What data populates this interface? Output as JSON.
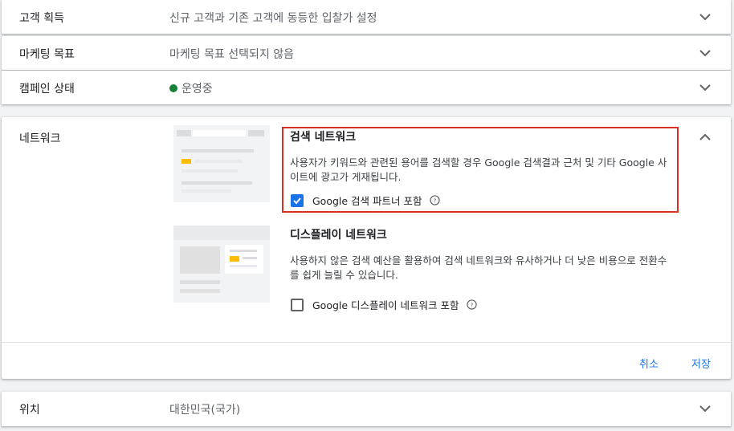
{
  "rows": {
    "customer": {
      "label": "고객 획득",
      "value": "신규 고객과 기존 고객에 동등한 입찰가 설정"
    },
    "marketing": {
      "label": "마케팅 목표",
      "value": "마케팅 목표 선택되지 않음"
    },
    "status": {
      "label": "캠페인 상태",
      "value": "운영중",
      "dot_color": "#188038"
    },
    "location": {
      "label": "위치",
      "value": "대한민국(국가)"
    }
  },
  "network": {
    "label": "네트워크",
    "search": {
      "title": "검색 네트워크",
      "desc": "사용자가 키워드와 관련된 용어를 검색할 경우 Google 검색결과 근처 및 기타 Google 사이트에 광고가 게재됩니다.",
      "checkbox_label": "Google 검색 파트너 포함",
      "checked": true
    },
    "display": {
      "title": "디스플레이 네트워크",
      "desc": "사용하지 않은 검색 예산을 활용하여 검색 네트워크와 유사하거나 더 낮은 비용으로 전환수를 쉽게 늘릴 수 있습니다.",
      "checkbox_label": "Google 디스플레이 네트워크 포함",
      "checked": false
    },
    "cancel_label": "취소",
    "save_label": "저장"
  },
  "colors": {
    "accent": "#1a73e8",
    "highlight": "#d93025",
    "status_green": "#188038",
    "ad_yellow": "#fbbc04"
  }
}
